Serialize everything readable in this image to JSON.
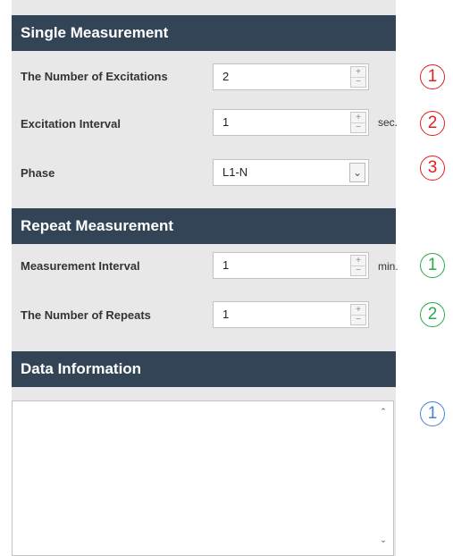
{
  "single": {
    "header": "Single Measurement",
    "excitations_label": "The Number of Excitations",
    "excitations_value": "2",
    "interval_label": "Excitation Interval",
    "interval_value": "1",
    "interval_unit": "sec.",
    "phase_label": "Phase",
    "phase_value": "L1-N"
  },
  "repeat": {
    "header": "Repeat Measurement",
    "interval_label": "Measurement Interval",
    "interval_value": "1",
    "interval_unit": "min.",
    "repeats_label": "The Number of Repeats",
    "repeats_value": "1"
  },
  "data_info": {
    "header": "Data Information",
    "content": ""
  },
  "spinner": {
    "up": "+",
    "down": "−"
  },
  "markers": [
    {
      "label": "1",
      "color": "#e02020"
    },
    {
      "label": "2",
      "color": "#e02020"
    },
    {
      "label": "3",
      "color": "#e02020"
    },
    {
      "label": "1",
      "color": "#2ba84a"
    },
    {
      "label": "2",
      "color": "#2ba84a"
    },
    {
      "label": "1",
      "color": "#4a7fd1"
    }
  ],
  "colors": {
    "header_bg": "#334457",
    "panel_bg": "#e8e8e8"
  }
}
